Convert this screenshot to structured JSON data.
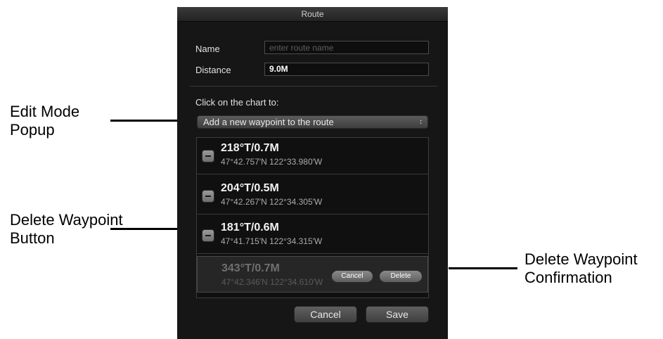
{
  "window": {
    "title": "Route"
  },
  "form": {
    "name_label": "Name",
    "name_placeholder": "enter route name",
    "name_value": "",
    "distance_label": "Distance",
    "distance_value": "9.0M"
  },
  "edit_mode": {
    "prompt": "Click on the chart to:",
    "selected": "Add a new waypoint to the route",
    "arrows": "↕"
  },
  "waypoints": [
    {
      "bearing": "218°T/0.7M",
      "position": "47°42.757′N 122°33.980′W"
    },
    {
      "bearing": "204°T/0.5M",
      "position": "47°42.267′N 122°34.305′W"
    },
    {
      "bearing": "181°T/0.6M",
      "position": "47°41.715′N 122°34.315′W"
    },
    {
      "bearing": "343°T/0.7M",
      "position": "47°42.346′N 122°34.610′W",
      "confirm_cancel": "Cancel",
      "confirm_delete": "Delete"
    }
  ],
  "footer": {
    "cancel": "Cancel",
    "save": "Save"
  },
  "callouts": {
    "edit_mode": [
      "Edit Mode",
      "Popup"
    ],
    "delete_button": [
      "Delete Waypoint",
      "Button"
    ],
    "delete_confirm": [
      "Delete Waypoint",
      "Confirmation"
    ]
  }
}
